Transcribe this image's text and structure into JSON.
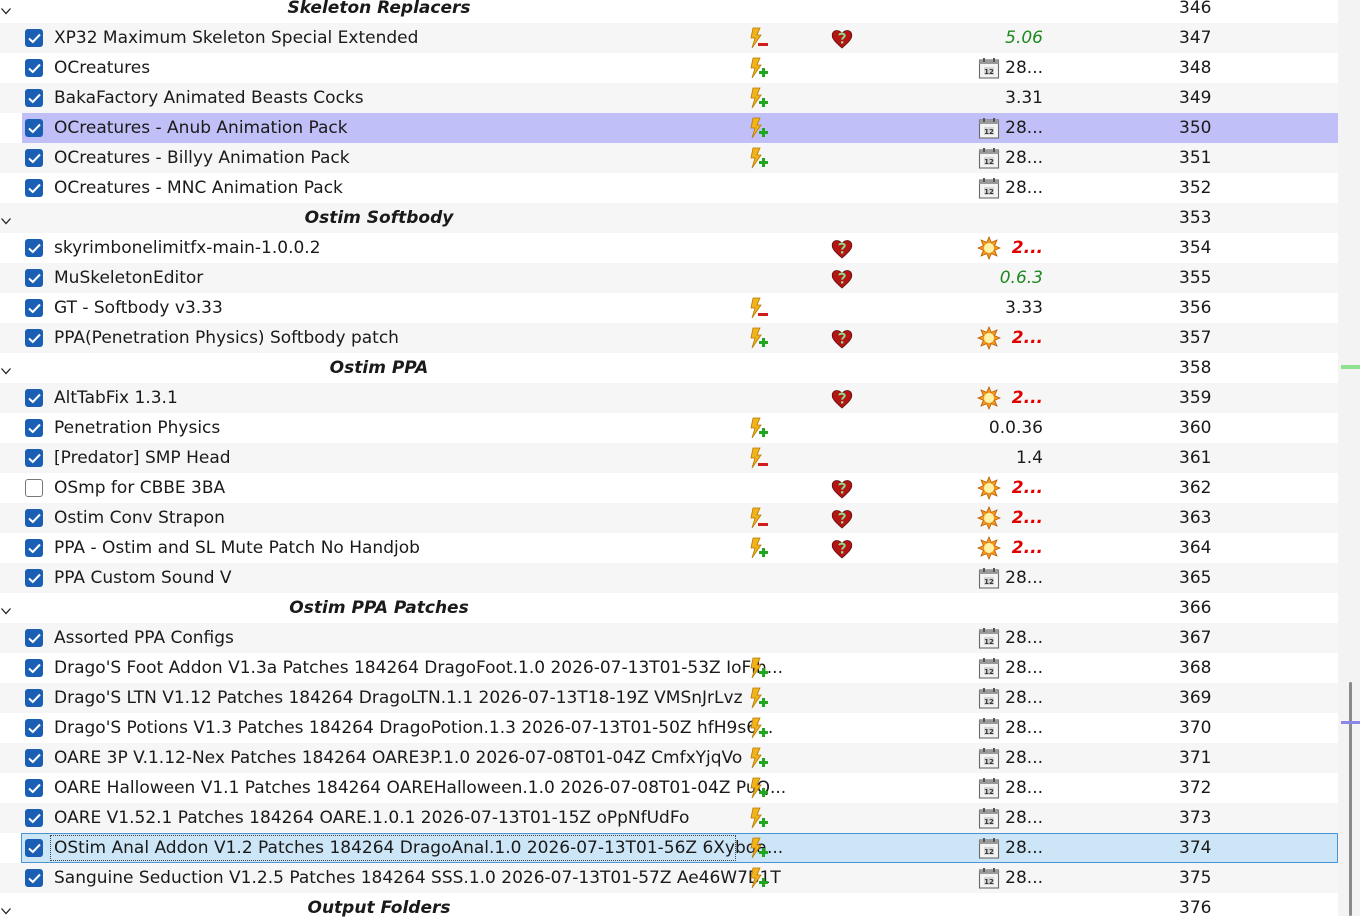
{
  "colors": {
    "accent": "#1a5fb4",
    "selection_purple": "#c1bff7",
    "selection_blue": "#cde6f7",
    "version_green": "#1e8a1e",
    "version_red": "#e00000"
  },
  "rows": [
    {
      "type": "separator",
      "name": "Skeleton Replacers",
      "priority": "346"
    },
    {
      "type": "mod",
      "name": "XP32 Maximum Skeleton Special Extended",
      "checked": true,
      "flag": "flash-minus",
      "heart": true,
      "version_icon": "",
      "version": "5.06",
      "version_style": "green",
      "priority": "347"
    },
    {
      "type": "mod",
      "name": "OCreatures",
      "checked": true,
      "flag": "flash-plus",
      "heart": false,
      "version_icon": "calendar",
      "version": "28...",
      "version_style": "",
      "priority": "348"
    },
    {
      "type": "mod",
      "name": "BakaFactory Animated Beasts Cocks",
      "checked": true,
      "flag": "flash-plus",
      "heart": false,
      "version_icon": "",
      "version": "3.31",
      "version_style": "",
      "priority": "349"
    },
    {
      "type": "mod",
      "name": "OCreatures - Anub Animation Pack",
      "checked": true,
      "flag": "flash-plus",
      "heart": false,
      "version_icon": "calendar",
      "version": "28...",
      "version_style": "",
      "priority": "350",
      "selected": "purple"
    },
    {
      "type": "mod",
      "name": "OCreatures - Billyy Animation Pack",
      "checked": true,
      "flag": "flash-plus",
      "heart": false,
      "version_icon": "calendar",
      "version": "28...",
      "version_style": "",
      "priority": "351"
    },
    {
      "type": "mod",
      "name": "OCreatures - MNC Animation Pack",
      "checked": true,
      "flag": "",
      "heart": false,
      "version_icon": "calendar",
      "version": "28...",
      "version_style": "",
      "priority": "352"
    },
    {
      "type": "separator",
      "name": "Ostim Softbody",
      "priority": "353"
    },
    {
      "type": "mod",
      "name": "skyrimbonelimitfx-main-1.0.0.2",
      "checked": true,
      "flag": "",
      "heart": true,
      "version_icon": "sun",
      "version": "2...",
      "version_style": "red",
      "priority": "354"
    },
    {
      "type": "mod",
      "name": "MuSkeletonEditor",
      "checked": true,
      "flag": "",
      "heart": true,
      "version_icon": "",
      "version": "0.6.3",
      "version_style": "green",
      "priority": "355"
    },
    {
      "type": "mod",
      "name": "GT - Softbody v3.33",
      "checked": true,
      "flag": "flash-minus",
      "heart": false,
      "version_icon": "",
      "version": "3.33",
      "version_style": "",
      "priority": "356"
    },
    {
      "type": "mod",
      "name": "PPA(Penetration Physics) Softbody patch",
      "checked": true,
      "flag": "flash-plus",
      "heart": true,
      "version_icon": "sun",
      "version": "2...",
      "version_style": "red",
      "priority": "357"
    },
    {
      "type": "separator",
      "name": "Ostim PPA",
      "priority": "358"
    },
    {
      "type": "mod",
      "name": "AltTabFix 1.3.1",
      "checked": true,
      "flag": "",
      "heart": true,
      "version_icon": "sun",
      "version": "2...",
      "version_style": "red",
      "priority": "359"
    },
    {
      "type": "mod",
      "name": "Penetration Physics",
      "checked": true,
      "flag": "flash-plus",
      "heart": false,
      "version_icon": "",
      "version": "0.0.36",
      "version_style": "",
      "priority": "360"
    },
    {
      "type": "mod",
      "name": "[Predator] SMP Head",
      "checked": true,
      "flag": "flash-minus",
      "heart": false,
      "version_icon": "",
      "version": "1.4",
      "version_style": "",
      "priority": "361"
    },
    {
      "type": "mod",
      "name": "OSmp for CBBE 3BA",
      "checked": false,
      "flag": "",
      "heart": true,
      "version_icon": "sun",
      "version": "2...",
      "version_style": "red",
      "priority": "362"
    },
    {
      "type": "mod",
      "name": "Ostim Conv Strapon",
      "checked": true,
      "flag": "flash-minus",
      "heart": true,
      "version_icon": "sun",
      "version": "2...",
      "version_style": "red",
      "priority": "363"
    },
    {
      "type": "mod",
      "name": "PPA - Ostim and SL Mute Patch No Handjob",
      "checked": true,
      "flag": "flash-plus",
      "heart": true,
      "version_icon": "sun",
      "version": "2...",
      "version_style": "red",
      "priority": "364"
    },
    {
      "type": "mod",
      "name": "PPA Custom Sound V",
      "checked": true,
      "flag": "",
      "heart": false,
      "version_icon": "calendar",
      "version": "28...",
      "version_style": "",
      "priority": "365"
    },
    {
      "type": "separator",
      "name": "Ostim PPA Patches",
      "priority": "366"
    },
    {
      "type": "mod",
      "name": "Assorted PPA Configs",
      "checked": true,
      "flag": "",
      "heart": false,
      "version_icon": "calendar",
      "version": "28...",
      "version_style": "",
      "priority": "367"
    },
    {
      "type": "mod",
      "name": "Drago'S Foot Addon V1.3a Patches 184264 DragoFoot.1.0 2026-07-13T01-53Z IoFlh...",
      "checked": true,
      "flag": "flash-plus",
      "heart": false,
      "version_icon": "calendar",
      "version": "28...",
      "version_style": "",
      "priority": "368"
    },
    {
      "type": "mod",
      "name": "Drago'S LTN V1.12 Patches 184264 DragoLTN.1.1 2026-07-13T18-19Z VMSnJrLvz",
      "checked": true,
      "flag": "flash-plus",
      "heart": false,
      "version_icon": "calendar",
      "version": "28...",
      "version_style": "",
      "priority": "369"
    },
    {
      "type": "mod",
      "name": "Drago'S Potions V1.3 Patches 184264 DragoPotion.1.3 2026-07-13T01-50Z hfH9s6...",
      "checked": true,
      "flag": "flash-plus",
      "heart": false,
      "version_icon": "calendar",
      "version": "28...",
      "version_style": "",
      "priority": "370"
    },
    {
      "type": "mod",
      "name": "OARE 3P V.1.12-Nex Patches 184264 OARE3P.1.0 2026-07-08T01-04Z CmfxYjqVo",
      "checked": true,
      "flag": "flash-plus",
      "heart": false,
      "version_icon": "calendar",
      "version": "28...",
      "version_style": "",
      "priority": "371"
    },
    {
      "type": "mod",
      "name": "OARE Halloween V1.1 Patches 184264 OAREHalloween.1.0 2026-07-08T01-04Z PuQ...",
      "checked": true,
      "flag": "flash-plus",
      "heart": false,
      "version_icon": "calendar",
      "version": "28...",
      "version_style": "",
      "priority": "372"
    },
    {
      "type": "mod",
      "name": "OARE V1.52.1 Patches 184264 OARE.1.0.1 2026-07-13T01-15Z oPpNfUdFo",
      "checked": true,
      "flag": "flash-plus",
      "heart": false,
      "version_icon": "calendar",
      "version": "28...",
      "version_style": "",
      "priority": "373"
    },
    {
      "type": "mod",
      "name": "OStim Anal Addon V1.2 Patches 184264 DragoAnal.1.0 2026-07-13T01-56Z 6Xybda...",
      "checked": true,
      "flag": "flash-plus",
      "heart": false,
      "version_icon": "calendar",
      "version": "28...",
      "version_style": "",
      "priority": "374",
      "selected": "blue"
    },
    {
      "type": "mod",
      "name": "Sanguine Seduction V1.2.5 Patches 184264 SSS.1.0 2026-07-13T01-57Z Ae46W7B1T",
      "checked": true,
      "flag": "flash-plus",
      "heart": false,
      "version_icon": "calendar",
      "version": "28...",
      "version_style": "",
      "priority": "375"
    },
    {
      "type": "separator",
      "name": "Output Folders",
      "priority": "376"
    }
  ]
}
